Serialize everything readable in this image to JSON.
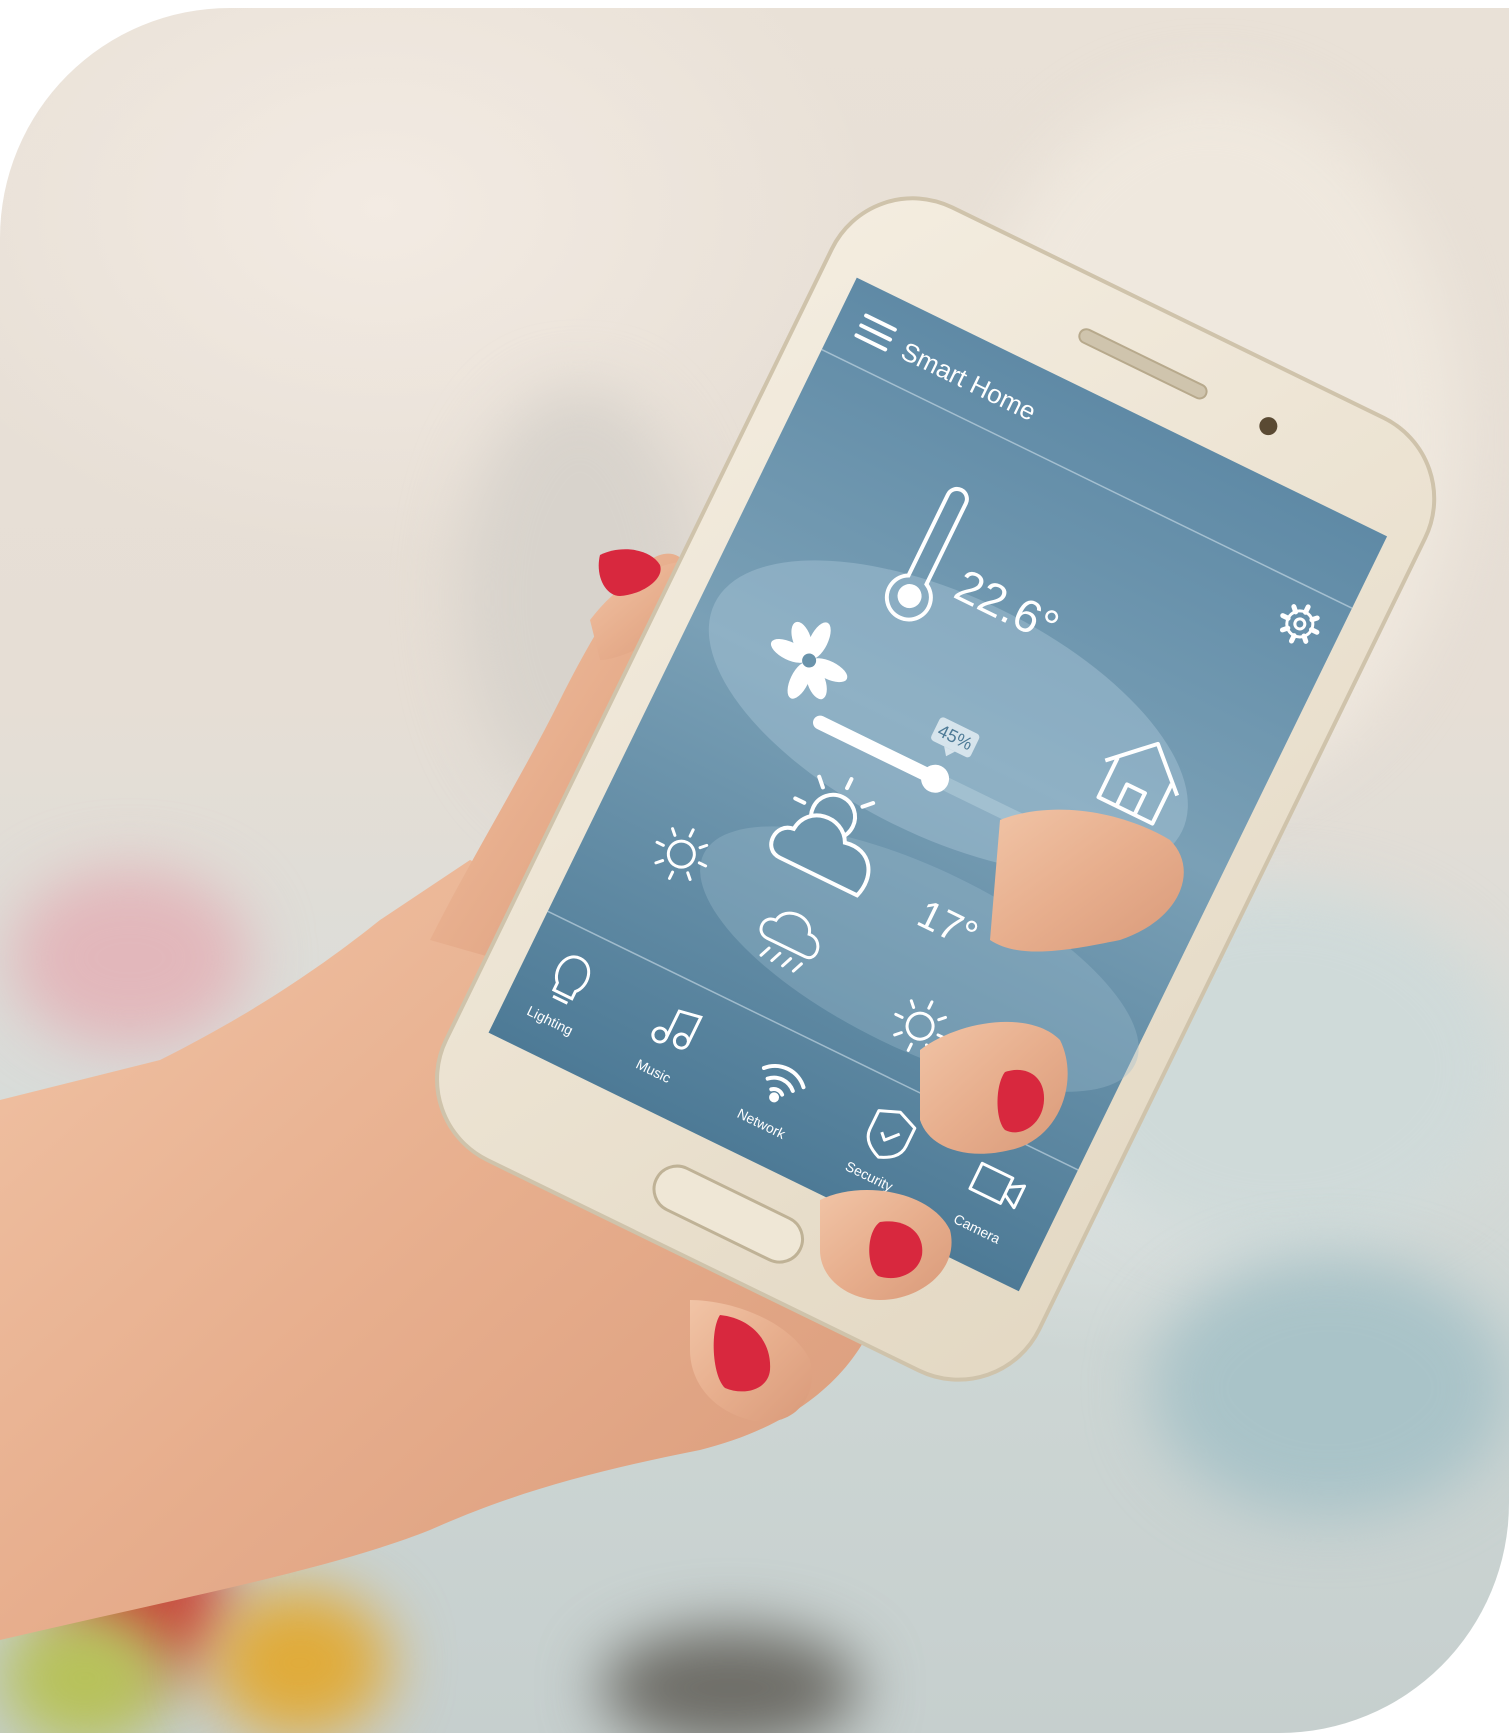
{
  "app": {
    "title": "Smart Home",
    "indoor_temperature": "22.6°",
    "fan_slider_value": "45%",
    "fan_level": 0.45,
    "outdoor_temperature": "17°"
  },
  "nav": {
    "items": [
      {
        "label": "Lighting",
        "icon": "bulb-icon"
      },
      {
        "label": "Music",
        "icon": "music-note-icon"
      },
      {
        "label": "Network",
        "icon": "wifi-icon"
      },
      {
        "label": "Security",
        "icon": "shield-check-icon"
      },
      {
        "label": "Camera",
        "icon": "video-camera-icon"
      }
    ]
  },
  "icons": {
    "menu": "hamburger-menu-icon",
    "settings": "gear-icon",
    "thermometer": "thermometer-icon",
    "fan": "fan-icon",
    "home": "house-icon",
    "weather_main": "partly-cloudy-icon",
    "forecast": [
      "sun-icon",
      "rain-cloud-icon",
      "sun-icon"
    ]
  },
  "colors": {
    "screen_top": "#5b87a3",
    "screen_bottom": "#4f7b97",
    "phone_body": "#eee6d6",
    "nail_polish": "#d8283e"
  }
}
